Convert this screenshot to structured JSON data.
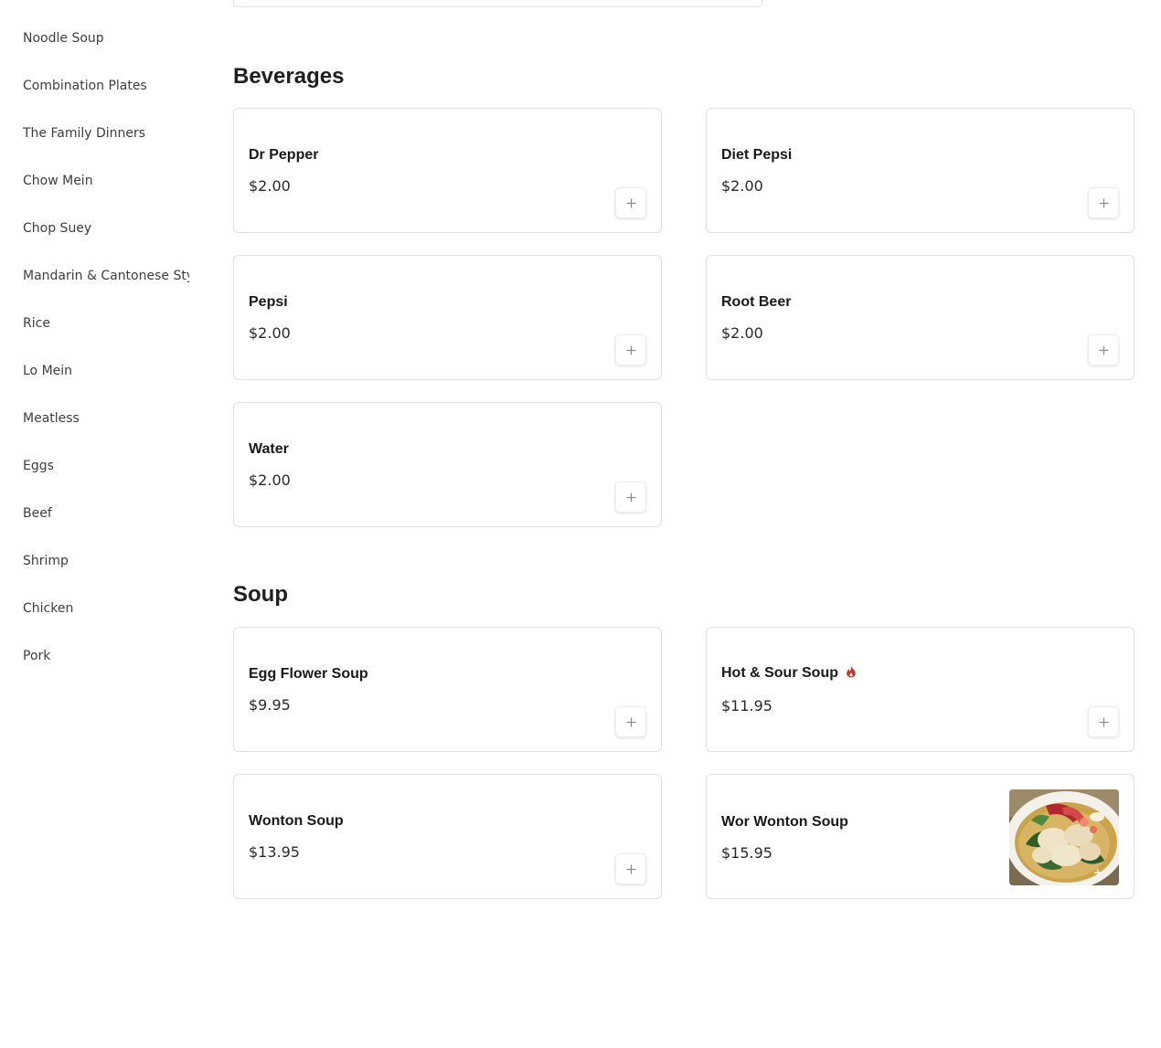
{
  "sidebar": {
    "items": [
      {
        "label": "Noodle Soup"
      },
      {
        "label": "Combination Plates"
      },
      {
        "label": "The Family Dinners"
      },
      {
        "label": "Chow Mein"
      },
      {
        "label": "Chop Suey"
      },
      {
        "label": "Mandarin & Cantonese Style"
      },
      {
        "label": "Rice"
      },
      {
        "label": "Lo Mein"
      },
      {
        "label": "Meatless"
      },
      {
        "label": "Eggs"
      },
      {
        "label": "Beef"
      },
      {
        "label": "Shrimp"
      },
      {
        "label": "Chicken"
      },
      {
        "label": "Pork"
      }
    ]
  },
  "sections": [
    {
      "title": "Beverages",
      "items": [
        {
          "name": "Dr Pepper",
          "price": "$2.00"
        },
        {
          "name": "Diet Pepsi",
          "price": "$2.00"
        },
        {
          "name": "Pepsi",
          "price": "$2.00"
        },
        {
          "name": "Root Beer",
          "price": "$2.00"
        },
        {
          "name": "Water",
          "price": "$2.00"
        }
      ]
    },
    {
      "title": "Soup",
      "items": [
        {
          "name": "Egg Flower Soup",
          "price": "$9.95"
        },
        {
          "name": "Hot & Sour Soup",
          "price": "$11.95",
          "icon": "spicy-flame-icon"
        },
        {
          "name": "Wonton Soup",
          "price": "$13.95"
        },
        {
          "name": "Wor Wonton Soup",
          "price": "$15.95",
          "image": "wonton-soup-photo"
        }
      ]
    }
  ],
  "colors": {
    "border": "#e0e0e0",
    "text": "#1a1a1a",
    "sidebar_text": "#3e3e3e",
    "spicy": "#c0392b"
  }
}
